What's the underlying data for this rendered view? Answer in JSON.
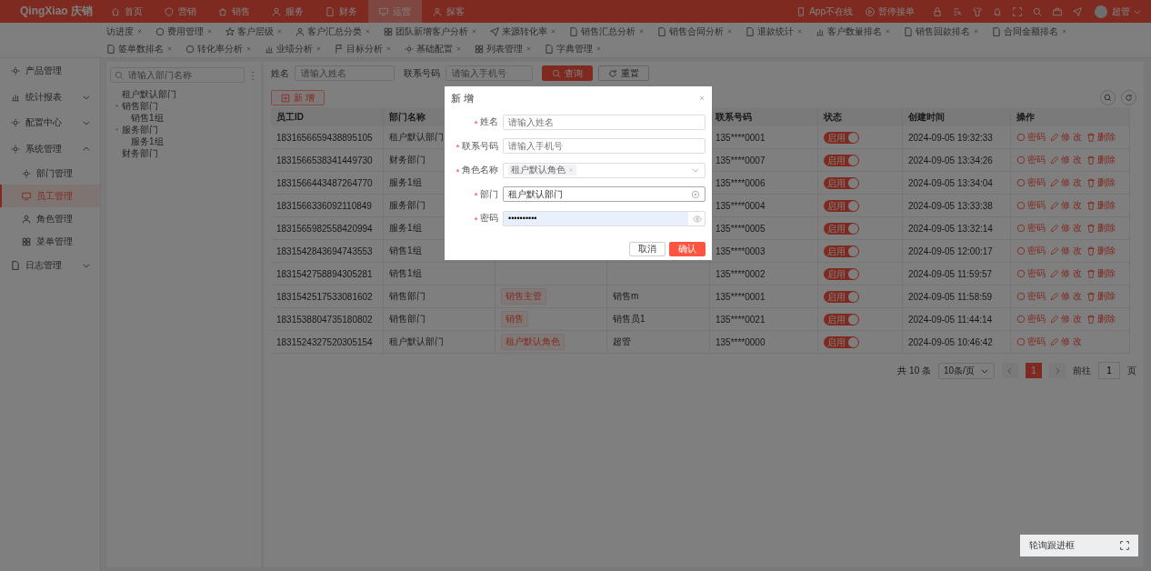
{
  "app": {
    "logo": "QingXiao 庆销",
    "nav": [
      {
        "label": "首页",
        "selected": false
      },
      {
        "label": "营销",
        "selected": false
      },
      {
        "label": "销售",
        "selected": false
      },
      {
        "label": "服务",
        "selected": false
      },
      {
        "label": "财务",
        "selected": false
      },
      {
        "label": "运营",
        "selected": true
      },
      {
        "label": "探客",
        "selected": false
      }
    ],
    "status": [
      "App不在线",
      "暂停接单"
    ],
    "user": "超管"
  },
  "tabs": [
    "访进度",
    "费用管理",
    "客户层级",
    "客户汇总分类",
    "团队新增客户分析",
    "来源转化率",
    "销售汇总分析",
    "销售合同分析",
    "退款统计",
    "客户数量排名",
    "销售回款排名",
    "合同金额排名",
    "签单数排名",
    "转化率分析",
    "业绩分析",
    "目标分析",
    "基础配置",
    "列表管理",
    "字典管理"
  ],
  "sidebar": {
    "items": [
      {
        "label": "产品管理",
        "selected": false
      },
      {
        "label": "统计报表",
        "expanded": false,
        "selected": false
      },
      {
        "label": "配置中心",
        "expanded": false,
        "selected": false
      },
      {
        "label": "系统管理",
        "expanded": true,
        "selected": false,
        "children": [
          {
            "label": "部门管理",
            "selected": false
          },
          {
            "label": "员工管理",
            "selected": true
          },
          {
            "label": "角色管理",
            "selected": false
          },
          {
            "label": "菜单管理",
            "selected": false
          }
        ]
      },
      {
        "label": "日志管理",
        "expanded": false,
        "selected": false
      }
    ]
  },
  "tree": {
    "placeholder": "请输入部门名称",
    "nodes": [
      {
        "label": "租户默认部门"
      },
      {
        "label": "销售部门",
        "expanded": true,
        "children": [
          {
            "label": "销售1组"
          }
        ]
      },
      {
        "label": "服务部门",
        "expanded": true,
        "children": [
          {
            "label": "服务1组"
          }
        ]
      },
      {
        "label": "财务部门"
      }
    ]
  },
  "filters": {
    "name_label": "姓名",
    "name_placeholder": "请输入姓名",
    "phone_label": "联系号码",
    "phone_placeholder": "请输入手机号",
    "search": "查询",
    "reset": "重置"
  },
  "add_button": "新 增",
  "table": {
    "columns": [
      "员工ID",
      "部门名称",
      "联系号码",
      "状态",
      "创建时间",
      "操作"
    ],
    "rows": [
      {
        "id": "1831656659438895105",
        "dept": "租户默认部门",
        "phone": "135****0001",
        "status": "启用",
        "enabled": true,
        "created": "2024-09-05 19:32:33",
        "actions": [
          {
            "kind": "password",
            "label": "密码"
          },
          {
            "kind": "edit",
            "label": "修 改"
          },
          {
            "kind": "delete",
            "label": "删除"
          }
        ]
      },
      {
        "id": "1831566538341449730",
        "dept": "财务部门",
        "phone": "135****0007",
        "status": "启用",
        "enabled": true,
        "created": "2024-09-05 13:34:26",
        "actions": [
          {
            "kind": "password",
            "label": "密码"
          },
          {
            "kind": "edit",
            "label": "修 改"
          },
          {
            "kind": "delete",
            "label": "删除"
          }
        ]
      },
      {
        "id": "1831566443487264770",
        "dept": "服务1组",
        "phone": "135****0006",
        "status": "启用",
        "enabled": true,
        "created": "2024-09-05 13:34:04",
        "actions": [
          {
            "kind": "password",
            "label": "密码"
          },
          {
            "kind": "edit",
            "label": "修 改"
          },
          {
            "kind": "delete",
            "label": "删除"
          }
        ]
      },
      {
        "id": "1831566336092110849",
        "dept": "服务部门",
        "phone": "135****0004",
        "status": "启用",
        "enabled": true,
        "created": "2024-09-05 13:33:38",
        "actions": [
          {
            "kind": "password",
            "label": "密码"
          },
          {
            "kind": "edit",
            "label": "修 改"
          },
          {
            "kind": "delete",
            "label": "删除"
          }
        ]
      },
      {
        "id": "1831565982558420994",
        "dept": "服务1组",
        "phone": "135****0005",
        "status": "启用",
        "enabled": true,
        "created": "2024-09-05 13:32:14",
        "actions": [
          {
            "kind": "password",
            "label": "密码"
          },
          {
            "kind": "edit",
            "label": "修 改"
          },
          {
            "kind": "delete",
            "label": "删除"
          }
        ]
      },
      {
        "id": "1831542843694743553",
        "dept": "销售1组",
        "phone": "135****0003",
        "status": "启用",
        "enabled": true,
        "created": "2024-09-05 12:00:17",
        "actions": [
          {
            "kind": "password",
            "label": "密码"
          },
          {
            "kind": "edit",
            "label": "修 改"
          },
          {
            "kind": "delete",
            "label": "删除"
          }
        ]
      },
      {
        "id": "1831542758894305281",
        "dept": "销售1组",
        "phone": "135****0002",
        "status": "启用",
        "enabled": true,
        "created": "2024-09-05 11:59:57",
        "actions": [
          {
            "kind": "password",
            "label": "密码"
          },
          {
            "kind": "edit",
            "label": "修 改"
          },
          {
            "kind": "delete",
            "label": "删除"
          }
        ]
      },
      {
        "id": "1831542517533081602",
        "dept": "销售部门",
        "role": "销售主管",
        "account": "销售m",
        "phone": "135****0001",
        "status": "启用",
        "enabled": true,
        "created": "2024-09-05 11:58:59",
        "actions": [
          {
            "kind": "password",
            "label": "密码"
          },
          {
            "kind": "edit",
            "label": "修 改"
          },
          {
            "kind": "delete",
            "label": "删除"
          }
        ]
      },
      {
        "id": "1831538804735180802",
        "dept": "销售部门",
        "role": "销售",
        "account": "销售员1",
        "phone": "135****0021",
        "status": "启用",
        "enabled": true,
        "created": "2024-09-05 11:44:14",
        "actions": [
          {
            "kind": "password",
            "label": "密码"
          },
          {
            "kind": "edit",
            "label": "修 改"
          },
          {
            "kind": "delete",
            "label": "删除"
          }
        ]
      },
      {
        "id": "1831524327520305154",
        "dept": "租户默认部门",
        "role": "租户默认角色",
        "account": "超管",
        "phone": "135****0000",
        "status": "启用",
        "enabled": true,
        "created": "2024-09-05 10:46:42",
        "actions": [
          {
            "kind": "password",
            "label": "密码"
          },
          {
            "kind": "edit",
            "label": "修 改"
          }
        ]
      }
    ]
  },
  "pagination": {
    "total": "共 10 条",
    "page_size": "10条/页",
    "pages": [
      {
        "label": "1",
        "selected": true
      }
    ],
    "goto": "前往",
    "goto_value": "1",
    "goto_suffix": "页"
  },
  "modal": {
    "title": "新 增",
    "fields": [
      {
        "kind": "text",
        "label": "姓名",
        "required": true,
        "placeholder": "请输入姓名"
      },
      {
        "kind": "text",
        "label": "联系号码",
        "required": true,
        "placeholder": "请输入手机号"
      },
      {
        "kind": "tags",
        "label": "角色名称",
        "required": true,
        "tags": [
          "租户默认角色"
        ]
      },
      {
        "kind": "select",
        "label": "部门",
        "required": true,
        "value": "租户默认部门"
      },
      {
        "kind": "password",
        "label": "密码",
        "required": true,
        "value": "••••••••••"
      }
    ],
    "cancel": "取消",
    "confirm": "确认"
  },
  "widget": {
    "title": "轮询跟进框"
  }
}
